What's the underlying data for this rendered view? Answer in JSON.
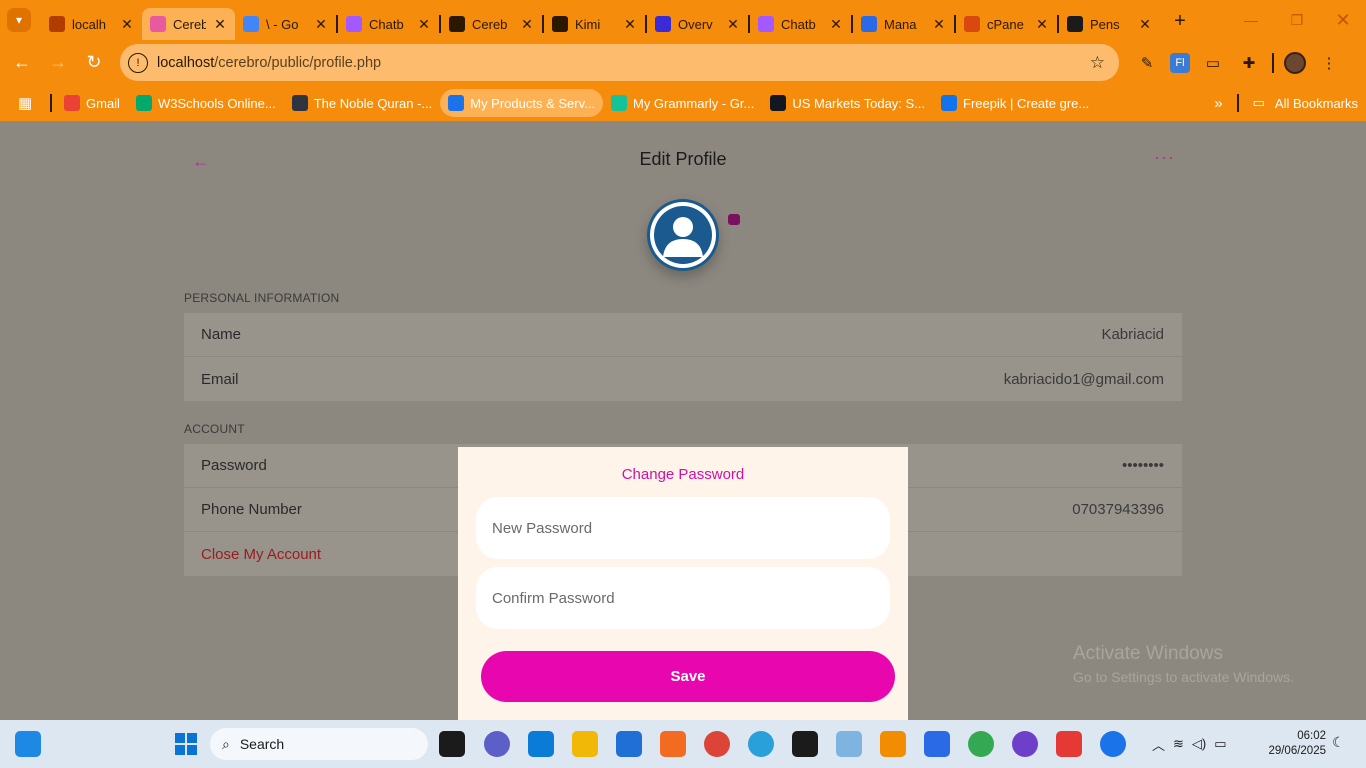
{
  "browser": {
    "tabs": [
      {
        "title": "localh",
        "favicon_color": "#b23b00",
        "active": false
      },
      {
        "title": "Cereb",
        "favicon_color": "#e85aa0",
        "active": true
      },
      {
        "title": "\\ - Go",
        "favicon_color": "#4285f4",
        "active": false
      },
      {
        "title": "Chatb",
        "favicon_color": "#a259ff",
        "active": false
      },
      {
        "title": "Cereb",
        "favicon_color": "#2a1800",
        "active": false
      },
      {
        "title": "Kimi",
        "favicon_color": "#2a1800",
        "active": false
      },
      {
        "title": "Overv",
        "favicon_color": "#3b2bd6",
        "active": false
      },
      {
        "title": "Chatb",
        "favicon_color": "#a259ff",
        "active": false
      },
      {
        "title": "Mana",
        "favicon_color": "#2b6ae6",
        "active": false
      },
      {
        "title": "cPane",
        "favicon_color": "#d9480f",
        "active": false
      },
      {
        "title": "Pens",
        "favicon_color": "#1b1b1b",
        "active": false
      }
    ],
    "tab_close_glyph": "✕",
    "new_tab_glyph": "+",
    "url_host": "localhost",
    "url_path": "/cerebro/public/profile.php",
    "bookmarks": [
      {
        "label": "Gmail",
        "color": "#ea4335",
        "active": false
      },
      {
        "label": "W3Schools Online...",
        "color": "#04aa6d",
        "active": false
      },
      {
        "label": "The Noble Quran -...",
        "color": "#2e3440",
        "active": false
      },
      {
        "label": "My Products & Serv...",
        "color": "#1a73e8",
        "active": true
      },
      {
        "label": "My Grammarly - Gr...",
        "color": "#15c39a",
        "active": false
      },
      {
        "label": "US Markets Today: S...",
        "color": "#131722",
        "active": false
      },
      {
        "label": "Freepik | Create gre...",
        "color": "#1273eb",
        "active": false
      }
    ],
    "all_bookmarks_label": "All Bookmarks"
  },
  "page": {
    "title": "Edit Profile",
    "personal_section_label": "PERSONAL INFORMATION",
    "personal_rows": [
      {
        "label": "Name",
        "value": "Kabriacid"
      },
      {
        "label": "Email",
        "value": "kabriacido1@gmail.com"
      }
    ],
    "account_section_label": "ACCOUNT",
    "account_rows": [
      {
        "label": "Password",
        "value": "••••••••"
      },
      {
        "label": "Phone Number",
        "value": "07037943396"
      }
    ],
    "close_account_label": "Close My Account"
  },
  "modal": {
    "title": "Change Password",
    "new_password_placeholder": "New Password",
    "confirm_password_placeholder": "Confirm Password",
    "save_label": "Save"
  },
  "watermark": {
    "line1": "Activate Windows",
    "line2": "Go to Settings to activate Windows."
  },
  "taskbar": {
    "search_label": "Search",
    "time": "06:02",
    "date": "29/06/2025"
  },
  "colors": {
    "browser_accent": "#f58c0c",
    "modal_accent": "#e806ae",
    "page_overlay": "#8c8880"
  }
}
